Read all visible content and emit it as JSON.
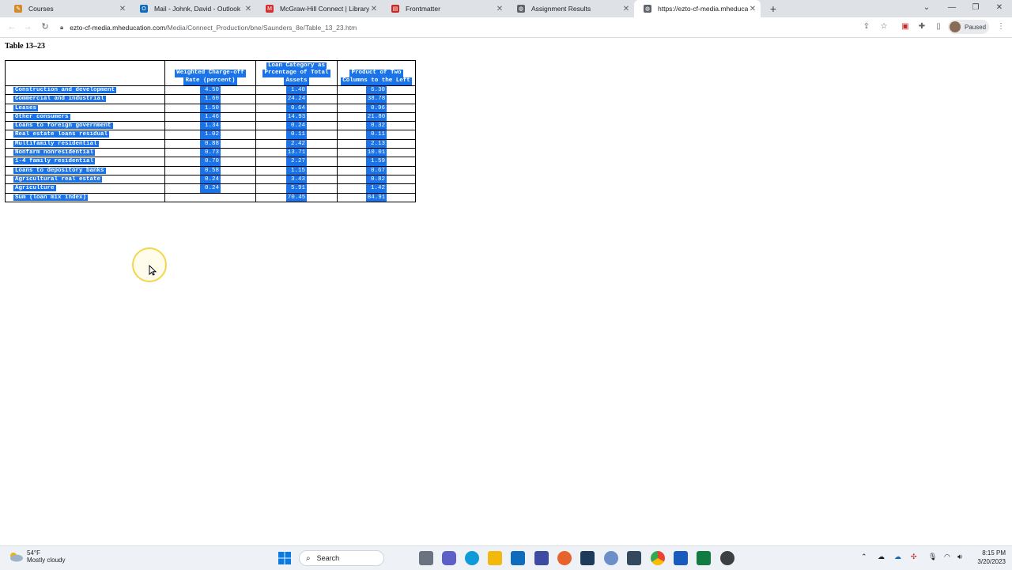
{
  "browser": {
    "tabs": [
      {
        "title": "Courses",
        "active": false,
        "favicon_color": "#d08c2c",
        "favicon_glyph": "✎"
      },
      {
        "title": "Mail - Johnk, David - Outlook",
        "active": false,
        "favicon_color": "#0f6cbd",
        "favicon_glyph": "O"
      },
      {
        "title": "McGraw-Hill Connect | Library H",
        "active": false,
        "favicon_color": "#d32f2f",
        "favicon_glyph": "M"
      },
      {
        "title": "Frontmatter",
        "active": false,
        "favicon_color": "#c62828",
        "favicon_glyph": "▤"
      },
      {
        "title": "Assignment Results",
        "active": false,
        "favicon_color": "#5f6368",
        "favicon_glyph": "◍"
      },
      {
        "title": "https://ezto-cf-media.mheducati",
        "active": true,
        "favicon_color": "#5f6368",
        "favicon_glyph": "◍"
      }
    ],
    "address": {
      "host": "ezto-cf-media.mheducation.com",
      "path": "/Media/Connect_Production/bne/Saunders_8e/Table_13_23.htm"
    },
    "profile_label": "Paused"
  },
  "page": {
    "title": "Table 13–23",
    "table": {
      "headers": [
        "",
        "Weighted Charge-off Rate (percent)",
        "Loan Category as Prcentage of Total Assets",
        "Product of Two Columns to the Left"
      ],
      "header_lines": [
        [
          ""
        ],
        [
          "Weighted Charge-off",
          "Rate (percent)"
        ],
        [
          "Loan Category as",
          "Prcentage of Total",
          "Assets"
        ],
        [
          "Product of Two",
          "Columns to the Left"
        ]
      ],
      "rows": [
        [
          "Construction and development",
          "4.50",
          "1.40",
          "6.30"
        ],
        [
          "Commercial and industrial",
          "1.60",
          "24.24",
          "38.78"
        ],
        [
          "Leases",
          "1.50",
          "0.64",
          "0.96"
        ],
        [
          "Other consumers",
          "1.46",
          "14.93",
          "21.80"
        ],
        [
          "Loans to foreign government",
          "1.34",
          "0.24",
          "0.32"
        ],
        [
          "Real estate loans residual",
          "1.02",
          "0.11",
          "0.11"
        ],
        [
          "Multifamily residential",
          "0.88",
          "2.42",
          "2.13"
        ],
        [
          "Nonfarm nonresidential",
          "0.73",
          "13.71",
          "10.01"
        ],
        [
          "1-4 family residential",
          "0.70",
          "2.27",
          "1.59"
        ],
        [
          "Loans to depository banks",
          "0.58",
          "1.15",
          "0.67"
        ],
        [
          "Agricultural real estate",
          "0.24",
          "3.43",
          "0.82"
        ],
        [
          "Agriculture",
          "0.24",
          "5.91",
          "1.42"
        ],
        [
          "Sum (loan mix index)",
          "",
          "70.45",
          "84.91"
        ]
      ]
    }
  },
  "taskbar": {
    "weather_temp": "54°F",
    "weather_desc": "Mostly cloudy",
    "search_label": "Search",
    "time": "8:15 PM",
    "date": "3/20/2023"
  },
  "colors": {
    "selection": "#1a73e8",
    "tabstrip": "#dee1e6"
  }
}
